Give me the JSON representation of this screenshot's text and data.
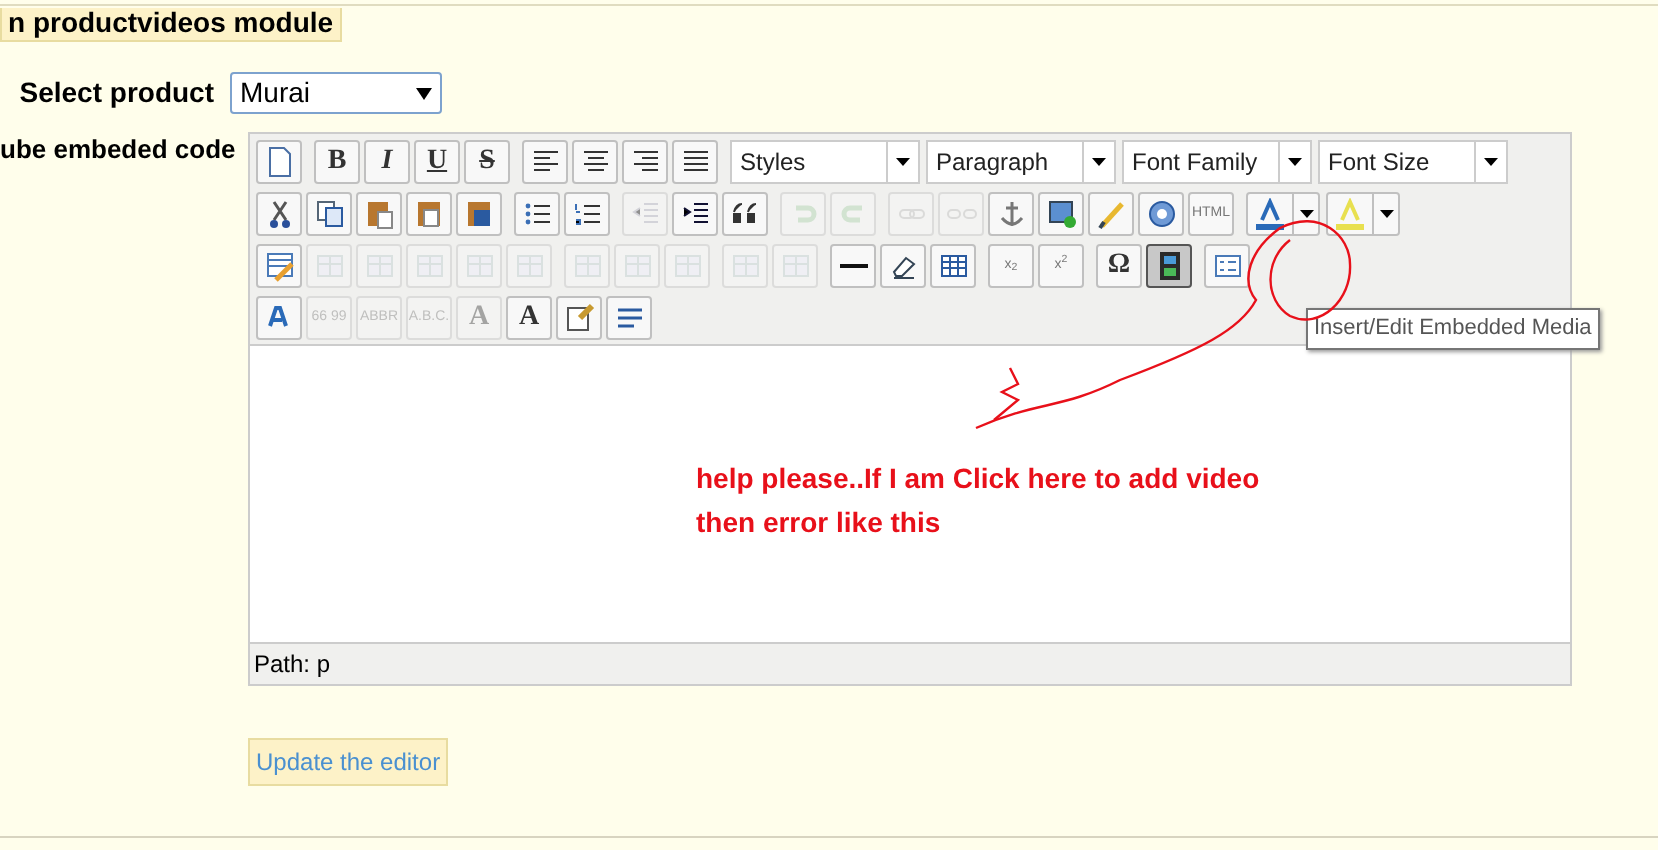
{
  "legend": "n productvideos module",
  "product_field": {
    "label": "Select product",
    "value": "Murai"
  },
  "embed_label": "ube embeded code",
  "toolbar": [
    [
      {
        "group": [
          {
            "disabled": false,
            "selected": false
          }
        ]
      },
      {
        "group": [
          {
            "label": "B",
            "disabled": false,
            "selected": false
          },
          {
            "label": "I",
            "disabled": false,
            "selected": false
          },
          {
            "label": "U",
            "disabled": false,
            "selected": false
          },
          {
            "label": "S",
            "disabled": false,
            "selected": false
          }
        ]
      },
      {
        "group": [
          {
            "disabled": false,
            "selected": false
          },
          {
            "disabled": false,
            "selected": false
          },
          {
            "disabled": false,
            "selected": false
          },
          {
            "disabled": false,
            "selected": false
          }
        ]
      }
    ],
    [
      {
        "group": [
          {
            "disabled": false,
            "selected": false
          },
          {
            "disabled": false,
            "selected": false
          },
          {
            "disabled": false,
            "selected": false
          },
          {
            "disabled": false,
            "selected": false
          },
          {
            "disabled": false,
            "selected": false
          }
        ]
      },
      {
        "group": [
          {
            "disabled": false,
            "selected": false
          },
          {
            "disabled": false,
            "selected": false
          }
        ]
      },
      {
        "group": [
          {
            "disabled": true,
            "selected": false
          },
          {
            "disabled": false,
            "selected": false
          },
          {
            "disabled": false,
            "selected": false
          }
        ]
      },
      {
        "group": [
          {
            "disabled": true,
            "selected": false
          },
          {
            "disabled": true,
            "selected": false
          }
        ]
      },
      {
        "group": [
          {
            "disabled": true,
            "selected": false
          },
          {
            "disabled": true,
            "selected": false
          },
          {
            "disabled": false,
            "selected": false
          },
          {
            "disabled": false,
            "selected": false
          },
          {
            "disabled": false,
            "selected": false
          },
          {
            "disabled": false,
            "selected": false
          },
          {
            "label": "HTML",
            "disabled": false,
            "selected": false
          }
        ]
      }
    ],
    [
      {
        "group": [
          {
            "disabled": false,
            "selected": false
          },
          {
            "disabled": true,
            "selected": false
          },
          {
            "disabled": true,
            "selected": false
          },
          {
            "disabled": true,
            "selected": false
          },
          {
            "disabled": true,
            "selected": false
          },
          {
            "disabled": true,
            "selected": false
          }
        ]
      },
      {
        "group": [
          {
            "disabled": true,
            "selected": false
          },
          {
            "disabled": true,
            "selected": false
          },
          {
            "disabled": true,
            "selected": false
          }
        ]
      },
      {
        "group": [
          {
            "disabled": true,
            "selected": false
          },
          {
            "disabled": true,
            "selected": false
          }
        ]
      },
      {
        "group": [
          {
            "disabled": false,
            "selected": false
          },
          {
            "disabled": false,
            "selected": false
          },
          {
            "disabled": false,
            "selected": false
          }
        ]
      },
      {
        "group": [
          {
            "label": "x$_{2}$",
            "disabled": false,
            "selected": false
          },
          {
            "label": "x$^{2}$",
            "disabled": false,
            "selected": false
          }
        ]
      },
      {
        "group": [
          {
            "label": "Ω",
            "disabled": false,
            "selected": false
          },
          {
            "disabled": false,
            "selected": true
          }
        ]
      },
      {
        "group": [
          {
            "disabled": false,
            "selected": false
          }
        ]
      }
    ],
    [
      {
        "group": [
          {
            "disabled": false,
            "selected": false
          },
          {
            "label": "66 99",
            "disabled": true,
            "selected": false
          },
          {
            "label": "ABBR",
            "disabled": true,
            "selected": false
          },
          {
            "label": "A.B.C.",
            "disabled": true,
            "selected": false
          },
          {
            "label": "A",
            "disabled": true,
            "selected": false
          },
          {
            "label": "A",
            "disabled": false,
            "selected": false
          },
          {
            "disabled": false,
            "selected": false
          },
          {
            "disabled": false,
            "selected": false
          }
        ]
      }
    ]
  ],
  "dropdowns": [
    "Styles",
    "Paragraph",
    "Font Family",
    "Font Size"
  ],
  "tooltip": "Insert/Edit Embedded Media",
  "annotation": "help please..If I am Click here to add video then error like this",
  "path": "Path: p",
  "update_button": "Update the editor"
}
